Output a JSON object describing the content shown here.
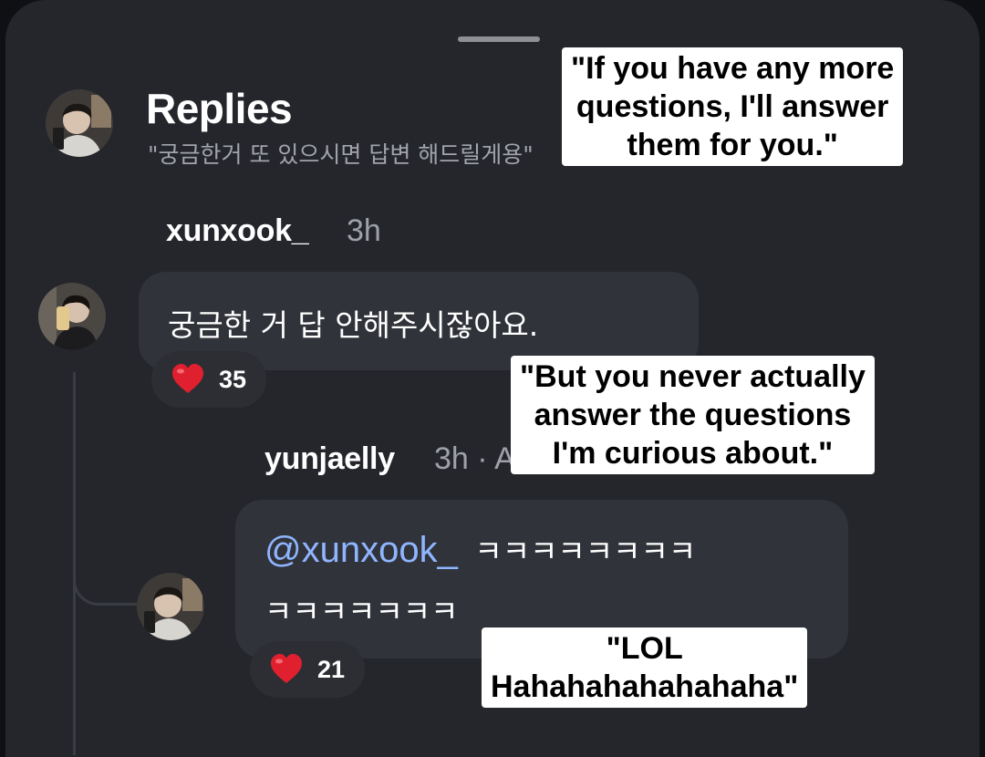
{
  "header": {
    "title": "Replies",
    "subtitle": "\"궁금한거 또 있으시면 답변 해드릴게용\""
  },
  "comments": [
    {
      "username": "xunxook_",
      "time": "3h",
      "text": "궁금한 거 답 안해주시잖아요.",
      "likes": "35"
    },
    {
      "username": "yunjaelly",
      "time": "3h · Ad",
      "mention": "@xunxook_",
      "text_line1": "ㅋㅋㅋㅋㅋㅋㅋㅋ",
      "text_line2": "ㅋㅋㅋㅋㅋㅋㅋ",
      "likes": "21"
    }
  ],
  "captions": {
    "top": "\"If you have any more\nquestions, I'll answer\nthem for you.\"",
    "middle": "\"But you never actually\nanswer the questions\nI'm curious about.\"",
    "bottom": "\"LOL\nHahahahahahahaha\""
  },
  "icons": {
    "reaction": "red-heart-icon"
  },
  "colors": {
    "background": "#24262c",
    "bubble": "#31333a",
    "mention": "#8fb5ff",
    "heart": "#e0202e"
  }
}
